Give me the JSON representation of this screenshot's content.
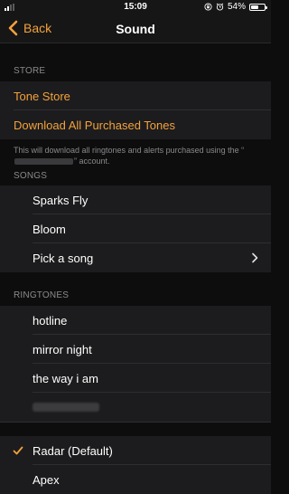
{
  "status_bar": {
    "time": "15:09",
    "battery": "54%",
    "battery_level": 0.54
  },
  "nav": {
    "back_label": "Back",
    "title": "Sound"
  },
  "store": {
    "header": "STORE",
    "tone_store": "Tone Store",
    "download_all": "Download All Purchased Tones",
    "footer_before": "This will download all ringtones and alerts purchased using the “",
    "footer_after": "” account."
  },
  "songs": {
    "header": "SONGS",
    "items": [
      "Sparks Fly",
      "Bloom",
      "Pick a song"
    ]
  },
  "ringtones": {
    "header": "RINGTONES",
    "items": [
      "hotline",
      "mirror night",
      "the way i am"
    ],
    "selected": "Radar (Default)",
    "next": "Apex"
  },
  "colors": {
    "accent": "#f4a23b",
    "background": "#0d0d0d",
    "cell": "#1c1c1e",
    "secondary_text": "#8a8a8e"
  },
  "icons": {
    "back": "chevron-left-icon",
    "disclosure": "chevron-right-icon",
    "selected": "checkmark-icon",
    "status": [
      "signal-icon",
      "lock-rotation-icon",
      "alarm-icon",
      "battery-icon"
    ]
  }
}
